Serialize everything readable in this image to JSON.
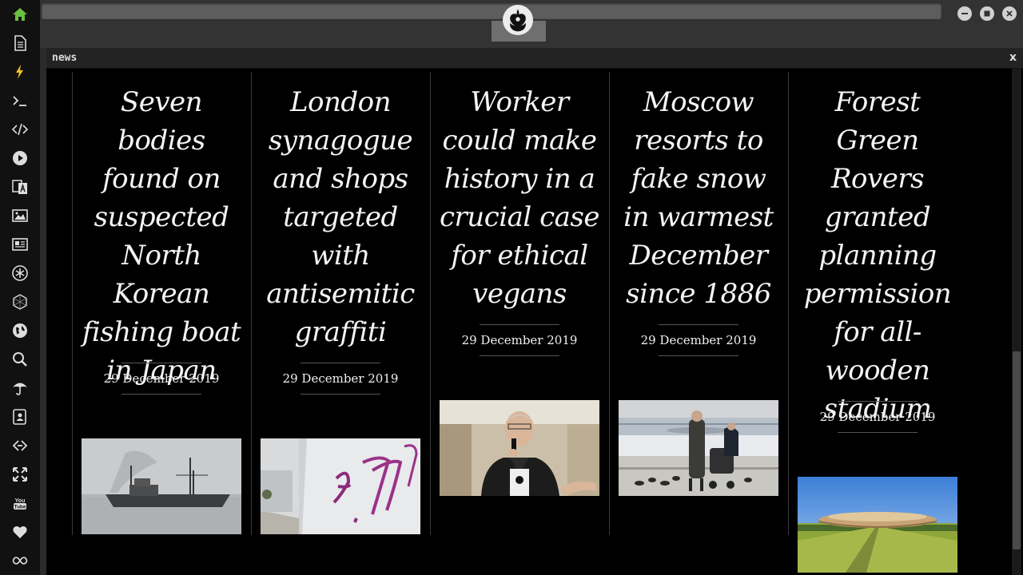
{
  "sidebar": {
    "items": [
      {
        "name": "home-icon",
        "color": "#6abf40"
      },
      {
        "name": "document-icon"
      },
      {
        "name": "lightning-icon",
        "color": "#f0c020"
      },
      {
        "name": "terminal-icon"
      },
      {
        "name": "code-icon"
      },
      {
        "name": "play-icon"
      },
      {
        "name": "translate-icon"
      },
      {
        "name": "image-icon"
      },
      {
        "name": "news-icon"
      },
      {
        "name": "asterisk-icon"
      },
      {
        "name": "hexagon-icon"
      },
      {
        "name": "globe-icon"
      },
      {
        "name": "search-icon"
      },
      {
        "name": "umbrella-icon"
      },
      {
        "name": "contact-icon"
      },
      {
        "name": "link-icon"
      },
      {
        "name": "expand-icon"
      },
      {
        "name": "youtube-icon"
      },
      {
        "name": "heart-icon"
      },
      {
        "name": "infinity-icon"
      }
    ]
  },
  "window": {
    "buttons": [
      "minimize",
      "maximize",
      "close"
    ]
  },
  "panel": {
    "title": "news",
    "close_label": "x"
  },
  "news": [
    {
      "headline": "Seven bodies found on suspected North Korean fishing boat in Japan",
      "date": "29 December 2019",
      "image": "fishing-boat"
    },
    {
      "headline": "London synagogue and shops targeted with antisemitic graffiti",
      "date": "29 December 2019",
      "image": "graffiti-wall"
    },
    {
      "headline": "Worker could make history in a crucial case for ethical vegans",
      "date": "29 December 2019",
      "image": "man-speaking"
    },
    {
      "headline": "Moscow resorts to fake snow in warmest December since 1886",
      "date": "29 December 2019",
      "image": "people-pram"
    },
    {
      "headline": "Forest Green Rovers granted planning permission for all-wooden stadium",
      "date": "29 December 2019",
      "image": "wooden-stadium"
    }
  ]
}
